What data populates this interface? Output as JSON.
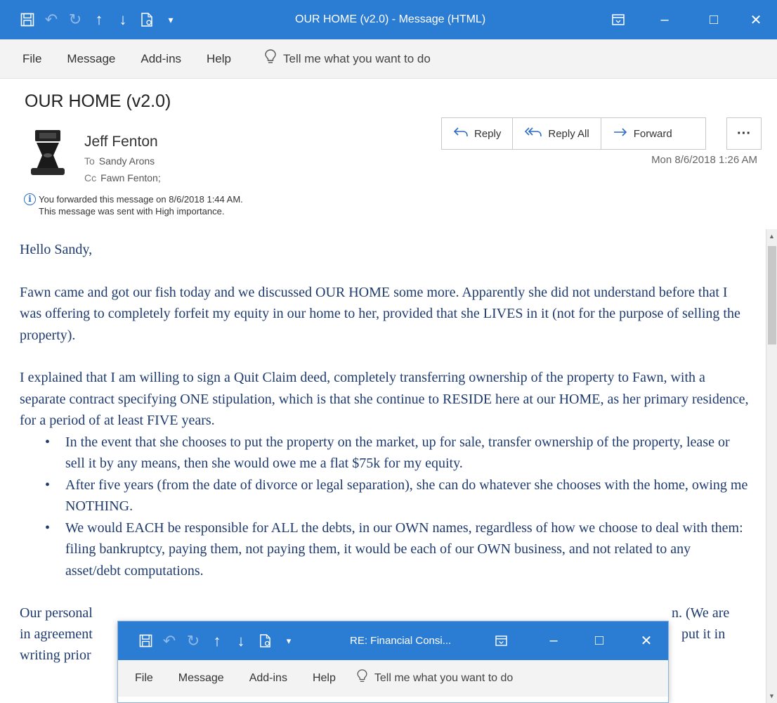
{
  "window": {
    "title": "OUR HOME (v2.0)  -  Message (HTML)",
    "controls": {
      "ribbon_display": "ribbon-display-icon",
      "minimize": "–",
      "maximize": "□",
      "close": "✕"
    }
  },
  "quick_access": [
    {
      "name": "save-icon",
      "glyph": "🖫"
    },
    {
      "name": "undo-icon",
      "glyph": "↶"
    },
    {
      "name": "redo-icon",
      "glyph": "↻"
    },
    {
      "name": "previous-item-icon",
      "glyph": "↑"
    },
    {
      "name": "next-item-icon",
      "glyph": "↓"
    },
    {
      "name": "attach-file-icon",
      "glyph": "🗎"
    },
    {
      "name": "customize-toolbar-icon",
      "glyph": "⩸"
    }
  ],
  "menu": {
    "file": "File",
    "message": "Message",
    "addins": "Add-ins",
    "help": "Help",
    "tell_me": "Tell me what you want to do"
  },
  "message": {
    "subject": "OUR HOME (v2.0)",
    "sender": "Jeff Fenton",
    "to_label": "To",
    "to": "Sandy Arons",
    "cc_label": "Cc",
    "cc": "Fawn Fenton;",
    "date": "Mon 8/6/2018 1:26 AM",
    "info_forwarded": "You forwarded this message on 8/6/2018 1:44 AM.",
    "info_importance": "This message was sent with High importance."
  },
  "actions": {
    "reply": "Reply",
    "reply_all": "Reply All",
    "forward": "Forward",
    "more": "···"
  },
  "body": {
    "greeting": "Hello Sandy,",
    "para1": "Fawn came and got our fish today and we discussed OUR HOME some more. Apparently she did not understand before that I was offering to completely forfeit my equity in our home to her, provided that she LIVES in it (not for the purpose of selling the property).",
    "para2": "I explained that I am willing to sign a Quit Claim deed, completely transferring ownership of the property to Fawn, with a separate contract specifying ONE stipulation, which is that she continue to RESIDE here at our HOME, as her primary residence, for a period of at least FIVE years.",
    "bullets": [
      "In the event that she chooses to put the property on the market, up for sale, transfer ownership of the property, lease or sell it by any means, then she would owe me a flat $75k for my equity.",
      "After five years (from the date of divorce or legal separation), she can do whatever she chooses with the home, owing me NOTHING.",
      "We would EACH be responsible for ALL the debts, in our OWN names, regardless of how we choose to deal with them: filing bankruptcy, paying them, not paying them, it would be each of our OWN business, and not related to any asset/debt computations."
    ],
    "para3_line1_start": "Our personal",
    "para3_line1_end": "n. (We are",
    "para3_line2_start": "in agreement",
    "para3_line2_end": "put it in",
    "para3_line3_start": "writing prior"
  },
  "overlay_window": {
    "title": "RE: Financial Consi...",
    "file": "File",
    "message": "Message",
    "addins": "Add-ins",
    "help": "Help",
    "tell_me": "Tell me what you want to do"
  }
}
